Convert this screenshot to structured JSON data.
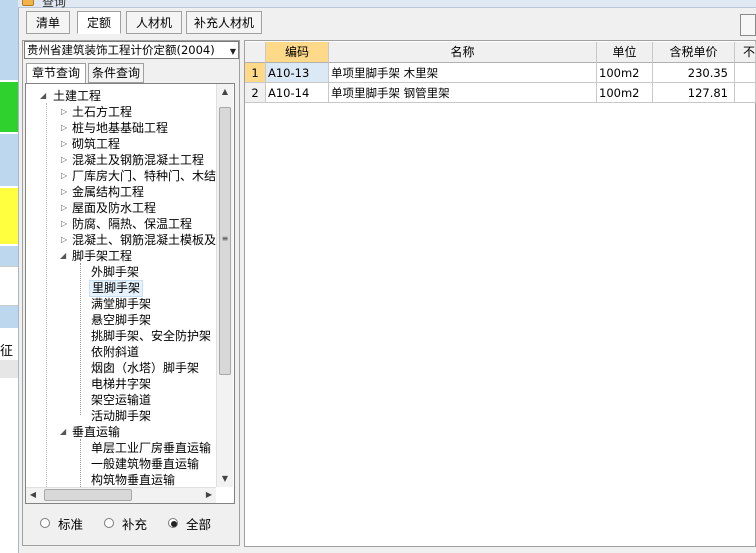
{
  "window": {
    "title": "查询"
  },
  "tabs": [
    "清单",
    "定额",
    "人材机",
    "补充人材机"
  ],
  "left_panel": {
    "quota_library": "贵州省建筑装饰工程计价定额(2004)",
    "search_tabs": [
      "章节查询",
      "条件查询"
    ],
    "tree": {
      "root": "土建工程",
      "chapters_before": [
        "土石方工程",
        "桩与地基基础工程",
        "砌筑工程",
        "混凝土及钢筋混凝土工程",
        "厂库房大门、特种门、木结",
        "金属结构工程",
        "屋面及防水工程",
        "防腐、隔热、保温工程",
        "混凝土、钢筋混凝土模板及"
      ],
      "scaffold": "脚手架工程",
      "scaffold_items": [
        "外脚手架",
        "里脚手架",
        "满堂脚手架",
        "悬空脚手架",
        "挑脚手架、安全防护架",
        "依附斜道",
        "烟囱（水塔）脚手架",
        "电梯井字架",
        "架空运输道",
        "活动脚手架"
      ],
      "vertical": "垂直运输",
      "vertical_items": [
        "单层工业厂房垂直运输",
        "一般建筑物垂直运输",
        "构筑物垂直运输"
      ]
    },
    "filter_options": [
      "标准",
      "补充",
      "全部"
    ],
    "filter_selected": "全部"
  },
  "grid": {
    "columns": [
      "编码",
      "名称",
      "单位",
      "含税单价",
      "不"
    ],
    "rows": [
      {
        "no": "1",
        "code": "A10-13",
        "name": "单项里脚手架 木里架",
        "unit": "100m2",
        "price": "230.35"
      },
      {
        "no": "2",
        "code": "A10-14",
        "name": "单项里脚手架 钢管里架",
        "unit": "100m2",
        "price": "127.81"
      }
    ]
  },
  "background_window": {
    "partial_label": "征"
  },
  "colors": {
    "selected_tree_bg": "#e5f1fb",
    "header_highlight": "#ffd98a",
    "row_highlight": "#dbe8f6",
    "green": "#2fd12f",
    "yellow": "#ffff40",
    "blue": "#bcd7ee"
  }
}
